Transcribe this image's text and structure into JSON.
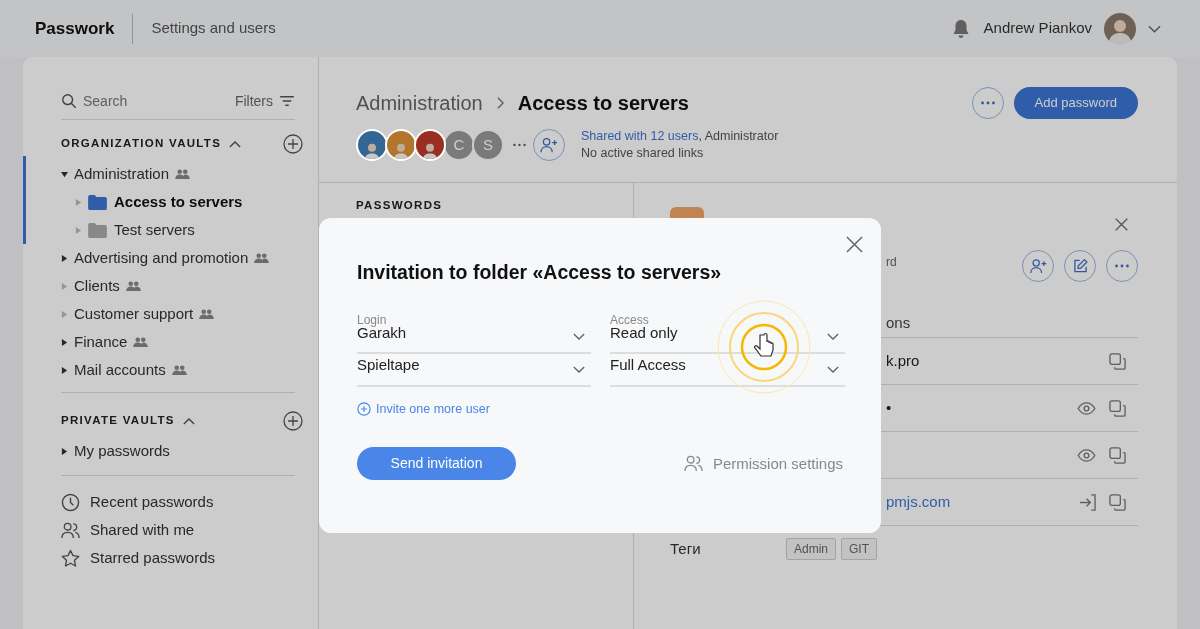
{
  "topbar": {
    "logo": "Passwork",
    "section": "Settings and users",
    "user_name": "Andrew Piankov"
  },
  "sidebar": {
    "search_placeholder": "Search",
    "filters": "Filters",
    "organization_vaults": {
      "title": "ORGANIZATION VAULTS",
      "expanded": true,
      "items": [
        {
          "label": "Administration",
          "shared": true,
          "has_children": true,
          "expanded": true,
          "selected": false,
          "children": [
            {
              "label": "Access to servers",
              "shared": false,
              "has_children": false,
              "expanded": false,
              "selected": true
            },
            {
              "label": "Test servers",
              "shared": false,
              "has_children": false,
              "expanded": false,
              "selected": false
            }
          ]
        },
        {
          "label": "Advertising and promotion",
          "shared": true,
          "has_children": true,
          "expanded": false,
          "selected": false
        },
        {
          "label": "Clients",
          "shared": true,
          "has_children": false,
          "expanded": false,
          "selected": false
        },
        {
          "label": "Customer support",
          "shared": true,
          "has_children": false,
          "expanded": false,
          "selected": false
        },
        {
          "label": "Finance",
          "shared": true,
          "has_children": true,
          "expanded": false,
          "selected": false
        },
        {
          "label": "Mail accounts",
          "shared": true,
          "has_children": true,
          "expanded": false,
          "selected": false
        }
      ]
    },
    "private_vaults": {
      "title": "PRIVATE VAULTS",
      "expanded": true,
      "items": [
        {
          "label": "My passwords",
          "shared": false,
          "has_children": true,
          "expanded": false,
          "selected": false
        }
      ]
    },
    "quick_links": [
      {
        "kind": "clock",
        "label": "Recent passwords"
      },
      {
        "kind": "people",
        "label": "Shared with me"
      },
      {
        "kind": "star",
        "label": "Starred passwords"
      }
    ]
  },
  "header": {
    "breadcrumb": [
      "Administration",
      "Access to servers"
    ],
    "add_button": "Add password",
    "members": [
      {
        "kind": "photo",
        "color": "#326693"
      },
      {
        "kind": "photo",
        "color": "#b3742e"
      },
      {
        "kind": "photo",
        "color": "#9a2e22"
      },
      {
        "kind": "letter",
        "letter": "C"
      },
      {
        "kind": "letter",
        "letter": "S"
      }
    ],
    "shared_link": "Shared with 12 users",
    "shared_role": ", Administrator",
    "links_note": "No active shared links"
  },
  "passwords_list": {
    "title": "PASSWORDS"
  },
  "detail": {
    "subtitle": "rd",
    "tab": "ons",
    "rows": [
      {
        "value": "k.pro",
        "kind": "text",
        "actions": [
          {
            "kind": "copy"
          }
        ]
      },
      {
        "value": "•",
        "kind": "text",
        "actions": [
          {
            "kind": "eye"
          },
          {
            "kind": "copy"
          }
        ]
      },
      {
        "actions": [
          {
            "kind": "eye"
          },
          {
            "kind": "copy"
          }
        ]
      },
      {
        "value": "pmjs.com",
        "kind": "link",
        "actions": [
          {
            "kind": "login"
          },
          {
            "kind": "copy"
          }
        ]
      }
    ],
    "tags_label": "Теги",
    "tags": [
      "Admin",
      "GIT"
    ]
  },
  "modal": {
    "title": "Invitation to folder «Access to servers»",
    "login_label": "Login",
    "access_label": "Access",
    "rows": [
      {
        "login": "Garakh",
        "access": "Read only"
      },
      {
        "login": "Spieltape",
        "access": "Full Access"
      }
    ],
    "invite_more": "Invite one more user",
    "send_button": "Send invitation",
    "permission_settings": "Permission settings"
  }
}
